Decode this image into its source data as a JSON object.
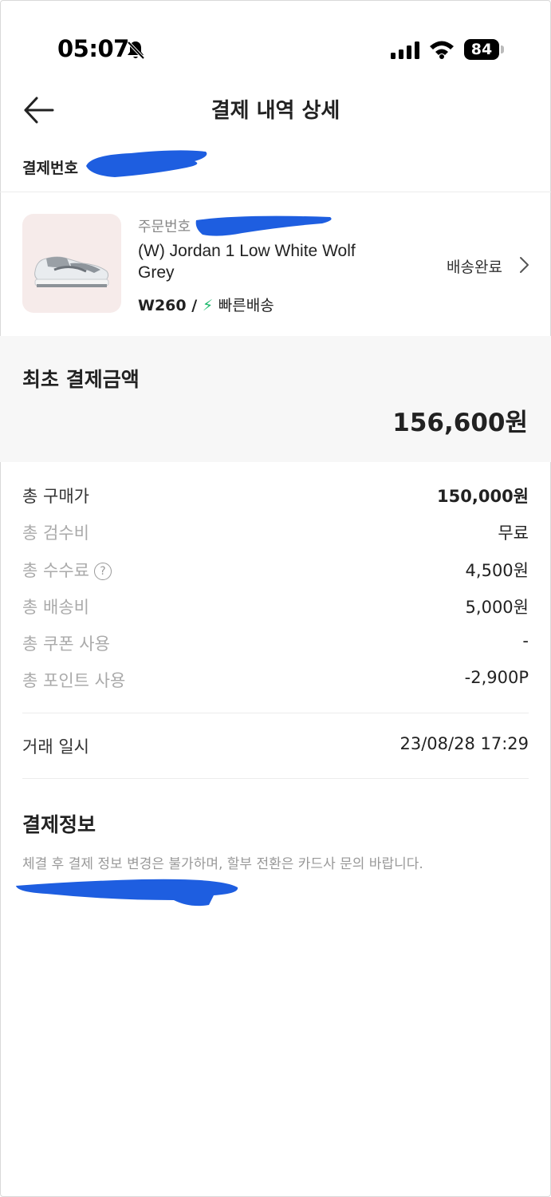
{
  "status_bar": {
    "time": "05:07",
    "battery": "84"
  },
  "header": {
    "title": "결제 내역 상세"
  },
  "payment_number_label": "결제번호",
  "product": {
    "order_number_label": "주문번호",
    "name": "(W) Jordan 1 Low White Wolf Grey",
    "size": "W260 /",
    "bolt": "⚡",
    "delivery_type": "빠른배송",
    "shipping_status": "배송완료"
  },
  "initial_payment": {
    "label": "최초 결제금액",
    "amount": "156,600원"
  },
  "details": [
    {
      "label": "총 구매가",
      "value": "150,000원"
    },
    {
      "label": "총 검수비",
      "value": "무료"
    },
    {
      "label": "총 수수료",
      "value": "4,500원"
    },
    {
      "label": "총 배송비",
      "value": "5,000원"
    },
    {
      "label": "총 쿠폰 사용",
      "value": "-"
    },
    {
      "label": "총 포인트 사용",
      "value": "-2,900P"
    }
  ],
  "transaction": {
    "label": "거래 일시",
    "value": "23/08/28 17:29"
  },
  "payment_info": {
    "title": "결제정보",
    "notice": "체결 후 결제 정보 변경은 불가하며, 할부 전환은 카드사 문의 바랍니다."
  },
  "colors": {
    "redaction": "#1e5ee0",
    "fast_delivery": "#1ab86b",
    "summary_bg": "#f7f7f7",
    "thumb_bg": "#f6ebea"
  },
  "icons": [
    "bell-off-icon",
    "cellular-signal-icon",
    "wifi-icon",
    "battery-icon",
    "back-arrow-icon",
    "chevron-right-icon",
    "help-icon",
    "sneaker-image"
  ]
}
